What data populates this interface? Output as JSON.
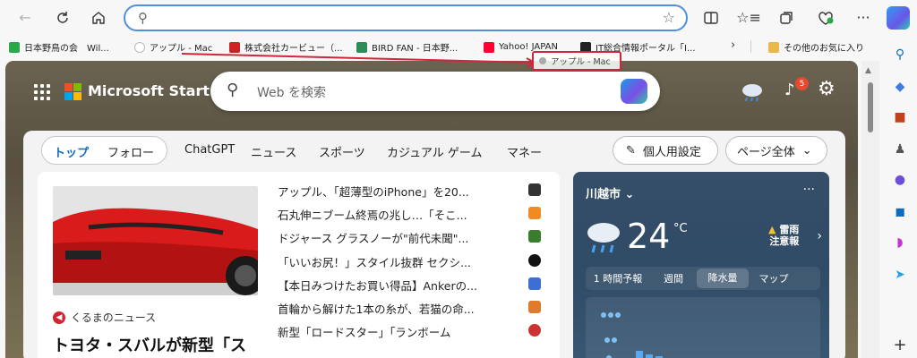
{
  "toolbar": {
    "address_value": "",
    "address_placeholder": ""
  },
  "bookmarks": [
    {
      "label": "日本野鳥の会　Wil...",
      "color": "#2aa84a"
    },
    {
      "label": "アップル - Mac",
      "color": "#111111"
    },
    {
      "label": "株式会社カービュー（...",
      "color": "#cc2222"
    },
    {
      "label": "BIRD FAN - 日本野...",
      "color": "#2e8b57"
    },
    {
      "label": "Yahoo! JAPAN",
      "color": "#ff0033"
    },
    {
      "label": "IT総合情報ポータル「I...",
      "color": "#222222"
    },
    {
      "label": "その他のお気に入り",
      "color": "#e8b84a"
    }
  ],
  "drag_tooltip": "アップル - Mac",
  "msn": {
    "brand": "Microsoft Start",
    "search_placeholder": "Web を検索",
    "notification_count": "5",
    "tabs": [
      "トップ",
      "フォロー",
      "ChatGPT",
      "ニュース",
      "スポーツ",
      "カジュアル ゲーム",
      "マネー"
    ],
    "personalize_label": "個人用設定",
    "page_dropdown_label": "ページ全体"
  },
  "feature": {
    "source": "くるまのニュース",
    "title": "トヨタ・スバルが新型「ス"
  },
  "news": [
    {
      "title": "アップル、「超薄型のiPhone」を20...",
      "color": "#333333"
    },
    {
      "title": "石丸伸ニブーム終焉の兆し…「そこ...",
      "color": "#f08a24"
    },
    {
      "title": "ドジャース グラスノーが\"前代未聞\"...",
      "color": "#3a7d2c"
    },
    {
      "title": "「いいお尻！」スタイル抜群 セクシ...",
      "color": "#111111"
    },
    {
      "title": "【本日みつけたお買い得品】Ankerの...",
      "color": "#3b6fd1"
    },
    {
      "title": "首輪から解けた1本の糸が、若猫の命...",
      "color": "#e07b2e"
    },
    {
      "title": "新型「ロードスター」「ランボーム",
      "color": "#cc3333"
    }
  ],
  "weather": {
    "city": "川越市",
    "temperature": "24",
    "unit": "°C",
    "alert_line1": "雷雨",
    "alert_line2": "注意報",
    "tabs": [
      "1 時間予報",
      "週間",
      "降水量",
      "マップ"
    ],
    "active_tab": "降水量"
  },
  "colors": {
    "address_border": "#4d8fe0",
    "drag_highlight": "#d0263b",
    "active_tab": "#0f6cbd",
    "badge": "#e8482f"
  }
}
